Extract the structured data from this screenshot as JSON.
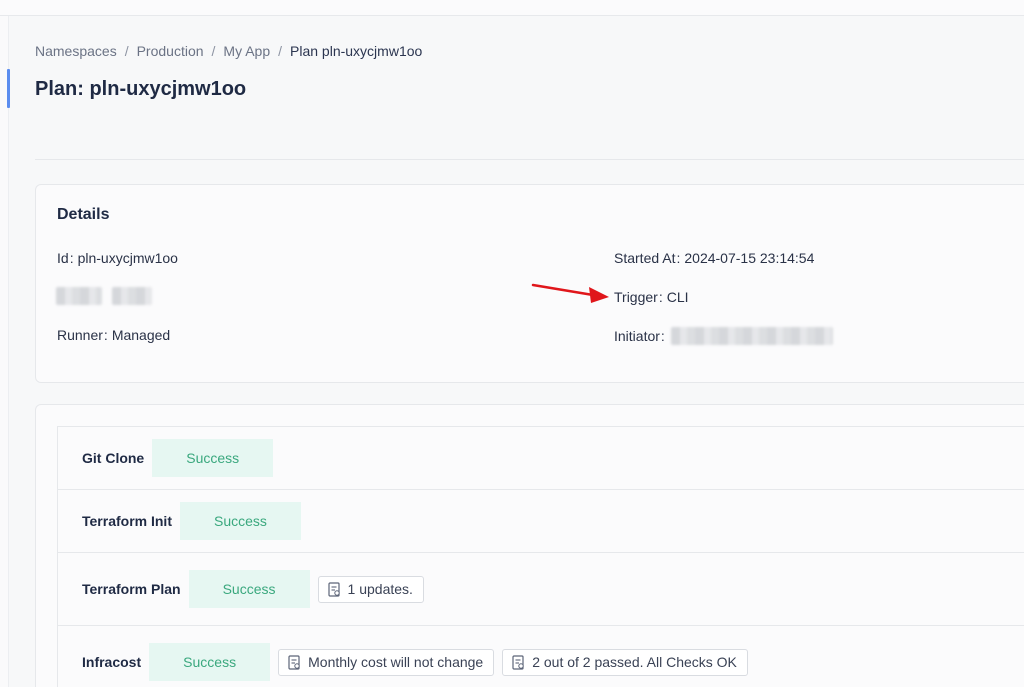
{
  "breadcrumb": {
    "items": [
      "Namespaces",
      "Production",
      "My App",
      "Plan pln-uxycjmw1oo"
    ],
    "separator": "/"
  },
  "page": {
    "title": "Plan: pln-uxycjmw1oo"
  },
  "details": {
    "heading": "Details",
    "id_label": "Id",
    "id_value": "pln-uxycjmw1oo",
    "runner_label": "Runner",
    "runner_value": "Managed",
    "started_label": "Started At",
    "started_value": "2024-07-15 23:14:54",
    "trigger_label": "Trigger",
    "trigger_value": "CLI",
    "initiator_label": "Initiator",
    "colon": ":"
  },
  "steps": [
    {
      "name": "Git Clone",
      "status": "Success"
    },
    {
      "name": "Terraform Init",
      "status": "Success"
    },
    {
      "name": "Terraform Plan",
      "status": "Success",
      "chips": [
        "1 updates."
      ]
    },
    {
      "name": "Infracost",
      "status": "Success",
      "chips": [
        "Monthly cost will not change",
        "2 out of 2 passed. All Checks OK"
      ]
    }
  ],
  "colors": {
    "success_bg": "#e6f7f2",
    "success_text": "#3aa87e",
    "annotation_arrow": "#e0161b",
    "accent": "#5b8def"
  },
  "icons": {
    "chip_icon": "report-icon",
    "annotation": "red-arrow-icon"
  }
}
